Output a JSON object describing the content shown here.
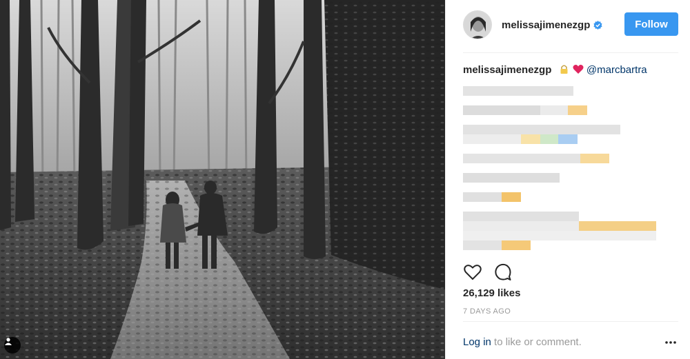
{
  "post": {
    "username": "melissajimenezgp",
    "follow_label": "Follow",
    "caption_author": "melissajimenezgp",
    "caption_mention": "@marcbartra",
    "likes": "26,129 likes",
    "timestamp": "7 DAYS AGO",
    "login_link": "Log in",
    "login_rest": " to like or comment."
  },
  "icons": {
    "verified": "verified-badge-icon",
    "like": "heart-outline-icon",
    "comment": "speech-bubble-icon",
    "more": "ellipsis-icon",
    "tag": "person-tag-icon",
    "emoji_1": "lock-emoji",
    "emoji_2": "red-heart-emoji"
  },
  "colors": {
    "follow_button": "#3897f0",
    "verified": "#3897f0",
    "link": "#003569",
    "muted": "#999999",
    "heart_emoji": "#e0245e",
    "pixel_highlight": "#f4bb4b"
  }
}
